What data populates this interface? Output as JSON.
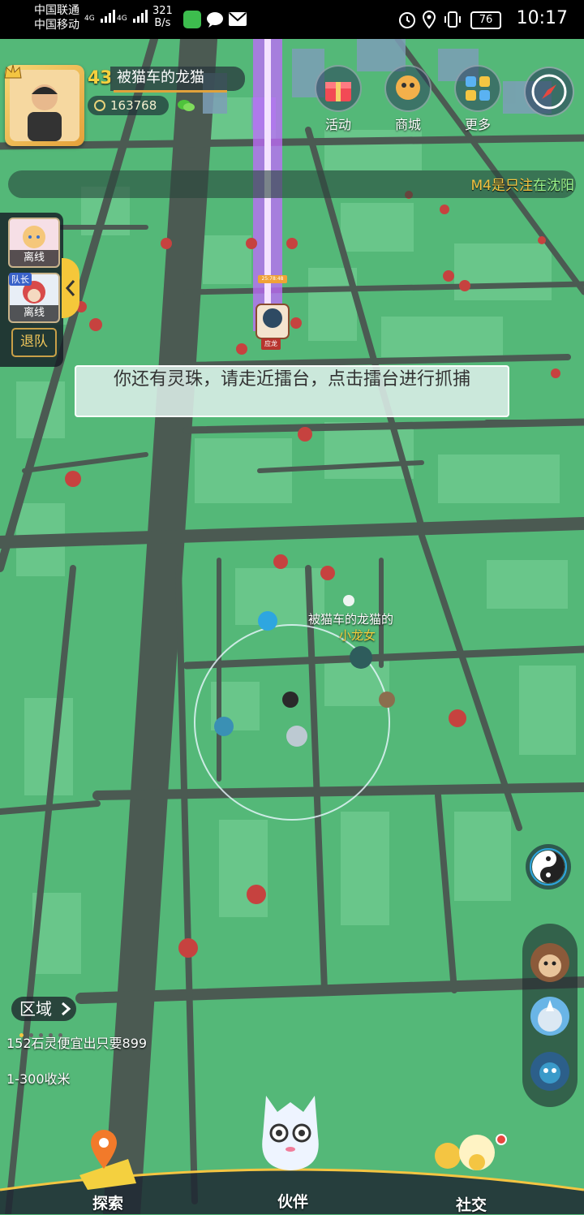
{
  "status_bar": {
    "carrier1": "中国联通",
    "carrier2": "中国移动",
    "signal1": "4G",
    "signal2": "4G",
    "speed_value": "321",
    "speed_unit": "B/s",
    "battery": "76",
    "time": "10:17"
  },
  "player": {
    "level": "43",
    "name": "被猫车的龙猫",
    "coins": "163768"
  },
  "top_buttons": {
    "activity": "活动",
    "shop": "商城",
    "more": "更多"
  },
  "notice": {
    "part1": "M4是只注",
    "part2": "在沈阳"
  },
  "team": {
    "member1_status": "离线",
    "leader_tag": "队长",
    "member2_status": "离线",
    "quit_label": "退队"
  },
  "tip": "你还有灵珠，请走近擂台，点击擂台进行抓捕",
  "map": {
    "arena_label": "应龙",
    "arena_badge": "25:78:48",
    "pet_owner_label": "被猫车的龙猫的",
    "pet_name_label": "小龙女"
  },
  "region": {
    "button_label": "区域",
    "ad_line1": "152石灵便宜出只要899",
    "ad_line2": "1-300收米"
  },
  "bottom_nav": {
    "explore": "探索",
    "partner": "伙伴",
    "social": "社交"
  },
  "colors": {
    "map_green": "#54b878",
    "road": "#4a5a50",
    "gold": "#f4c542",
    "beam": "#b24cff"
  }
}
